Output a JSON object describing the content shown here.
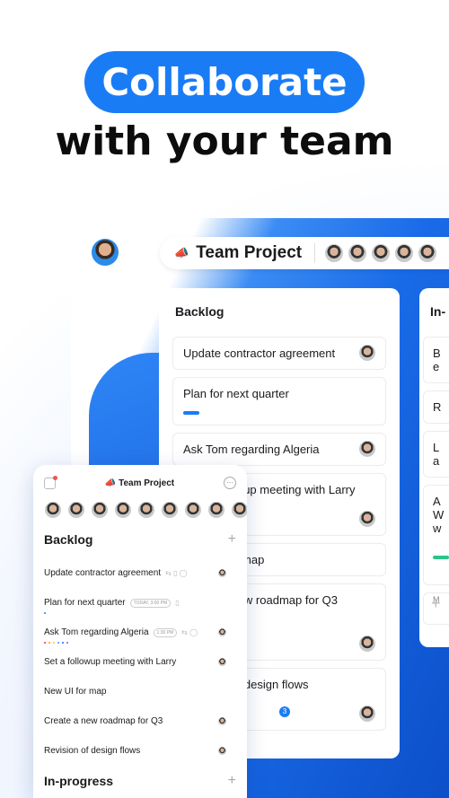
{
  "hero": {
    "title": "Collaborate",
    "subtitle": "with your team"
  },
  "project": {
    "name": "Team Project",
    "icon": "megaphone-icon"
  },
  "board": {
    "backlog": {
      "title": "Backlog",
      "cards": [
        "Update contractor agreement",
        "Plan for next quarter",
        "Ask Tom regarding Algeria",
        "Set a followup meeting with Larry",
        "New UI for map",
        "Create a new roadmap for Q3",
        "Revision of design flows"
      ],
      "comment_count": "3"
    },
    "inprogress": {
      "title": "In-",
      "cards": [
        "B\ne",
        "R",
        "L\na",
        "A\nW\nw"
      ],
      "meta": "M"
    }
  },
  "phone": {
    "title": "Team Project",
    "sections": {
      "backlog": "Backlog",
      "inprogress": "In-progress"
    },
    "items": [
      {
        "text": "Update contractor agreement"
      },
      {
        "text": "Plan for next quarter",
        "chip": "TODAY, 3:00 PM"
      },
      {
        "text": "Ask Tom regarding Algeria",
        "chip": "1:30 PM"
      },
      {
        "text": "Set a followup meeting with Larry"
      },
      {
        "text": "New UI for map"
      },
      {
        "text": "Create a new roadmap for Q3"
      },
      {
        "text": "Revision of design flows"
      }
    ]
  },
  "colors": {
    "accent": "#1a7cf5",
    "progress_green": "#2bc48a"
  }
}
